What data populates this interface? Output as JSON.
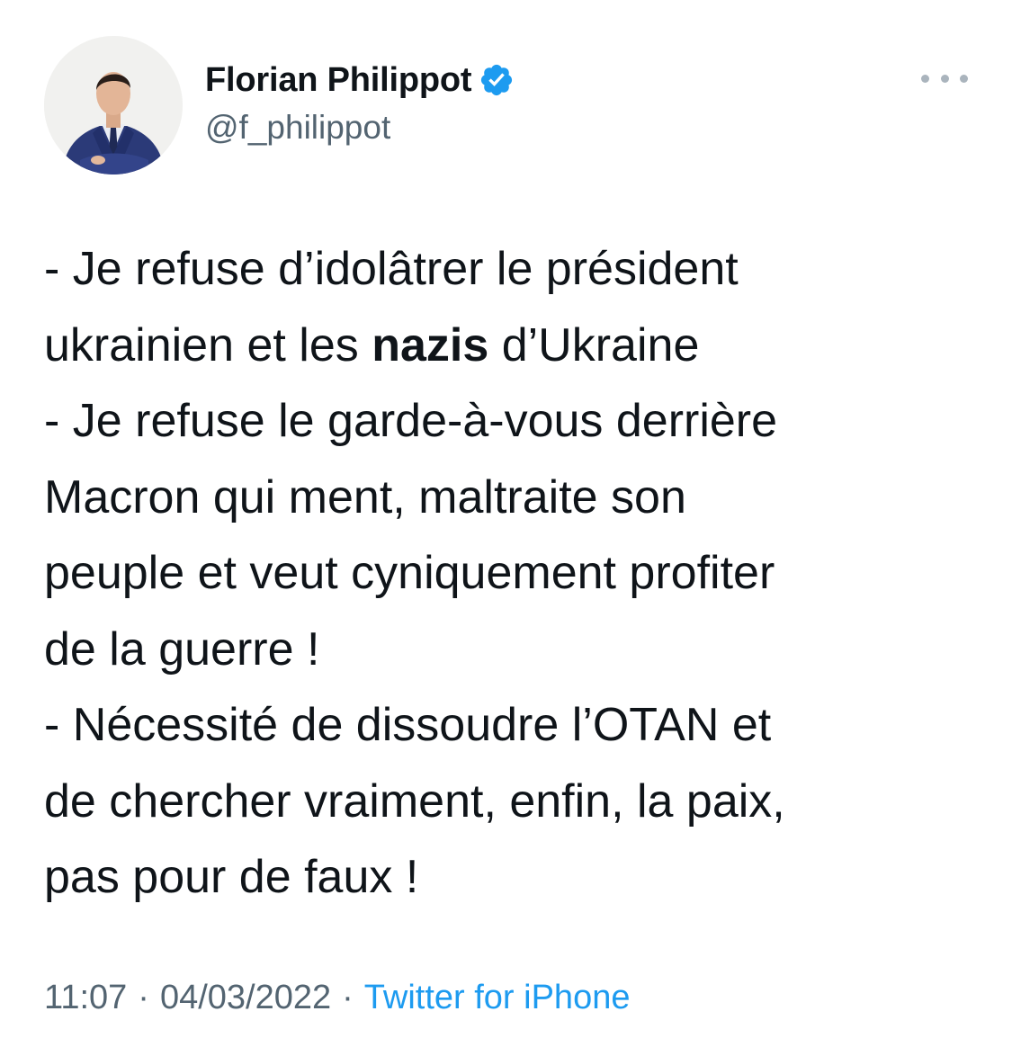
{
  "author": {
    "display_name": "Florian Philippot",
    "handle": "@f_philippot",
    "verified": true,
    "avatar_icon": "profile-photo",
    "verified_icon": "verified-badge-icon"
  },
  "more_icon": "more-dots-icon",
  "tweet": {
    "lines": [
      {
        "before": "- Je refuse d’idolâtrer le président",
        "bold": "",
        "after": ""
      },
      {
        "before": "ukrainien et les ",
        "bold": "nazis",
        "after": " d’Ukraine"
      },
      {
        "before": "- Je refuse le garde-à-vous derrière",
        "bold": "",
        "after": ""
      },
      {
        "before": "Macron qui ment, maltraite son",
        "bold": "",
        "after": ""
      },
      {
        "before": "peuple et veut cyniquement profiter",
        "bold": "",
        "after": ""
      },
      {
        "before": "de la guerre !",
        "bold": "",
        "after": ""
      },
      {
        "before": "- Nécessité de dissoudre l’OTAN et",
        "bold": "",
        "after": ""
      },
      {
        "before": "de chercher vraiment, enfin, la paix,",
        "bold": "",
        "after": ""
      },
      {
        "before": "pas pour de faux !",
        "bold": "",
        "after": ""
      }
    ]
  },
  "meta": {
    "time": "11:07",
    "separator": "·",
    "date": "04/03/2022",
    "source": "Twitter for iPhone"
  },
  "colors": {
    "text": "#0f1419",
    "secondary": "#536471",
    "link": "#1d9bf0",
    "verified": "#1d9bf0"
  }
}
